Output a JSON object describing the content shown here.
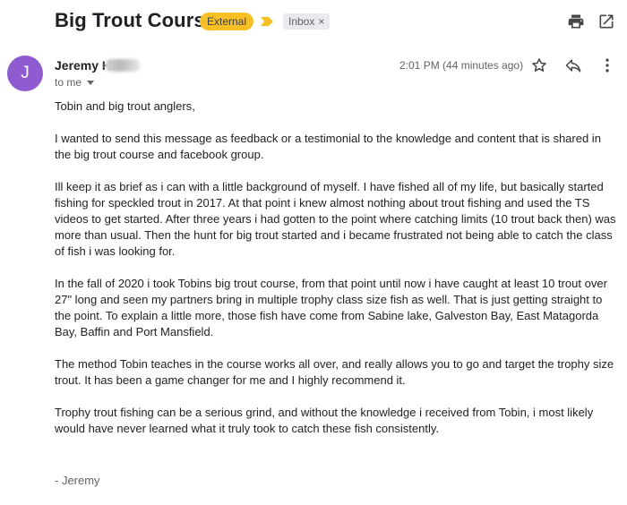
{
  "email": {
    "subject": "Big Trout Course",
    "labels": {
      "external": "External",
      "inbox": "Inbox",
      "inbox_remove": "×"
    },
    "sender": {
      "avatar_letter": "J",
      "name": "Jeremy H",
      "to": "to me",
      "timestamp": "2:01 PM (44 minutes ago)"
    },
    "body": {
      "greeting": "Tobin and big trout anglers,",
      "p1": "I wanted to send this message as feedback or a testimonial to the knowledge and content that is shared in the big trout course and facebook group.",
      "p2": "Ill keep it as brief as i can with a little background of myself.  I have fished all of my life, but basically started fishing for speckled trout in 2017.  At that point i knew almost nothing about trout fishing and used the TS videos to get started. After three years i had gotten to the point where catching limits (10 trout back then) was more than usual. Then the hunt for big trout started and i became frustrated not being able to catch the class of fish i was looking for.",
      "p3": "In the fall of 2020 i took Tobins big trout course, from that point until now i have caught at least 10 trout over 27\" long and seen my partners bring in multiple trophy class size fish as well.  That is just getting straight to the point. To explain a little more, those fish have come from Sabine lake, Galveston Bay, East Matagorda Bay, Baffin and Port Mansfield.",
      "p4": "The method Tobin teaches in the course works all over, and really allows you to go and target the trophy size trout. It has been a game changer for me and I highly recommend it.",
      "p5": "Trophy trout fishing can be a serious grind, and without the knowledge i received from Tobin, i most likely would have never learned what it truly took to catch these fish consistently.",
      "signature": "- Jeremy"
    }
  },
  "colors": {
    "external_label": "#f6c026",
    "avatar": "#8e5bd0",
    "importance": "#f6c026",
    "inbox_label": "#e8eaed"
  },
  "icons": [
    "print-icon",
    "open-in-new-window-icon",
    "star-icon",
    "reply-icon",
    "more-vert-icon",
    "importance-marker-icon"
  ]
}
